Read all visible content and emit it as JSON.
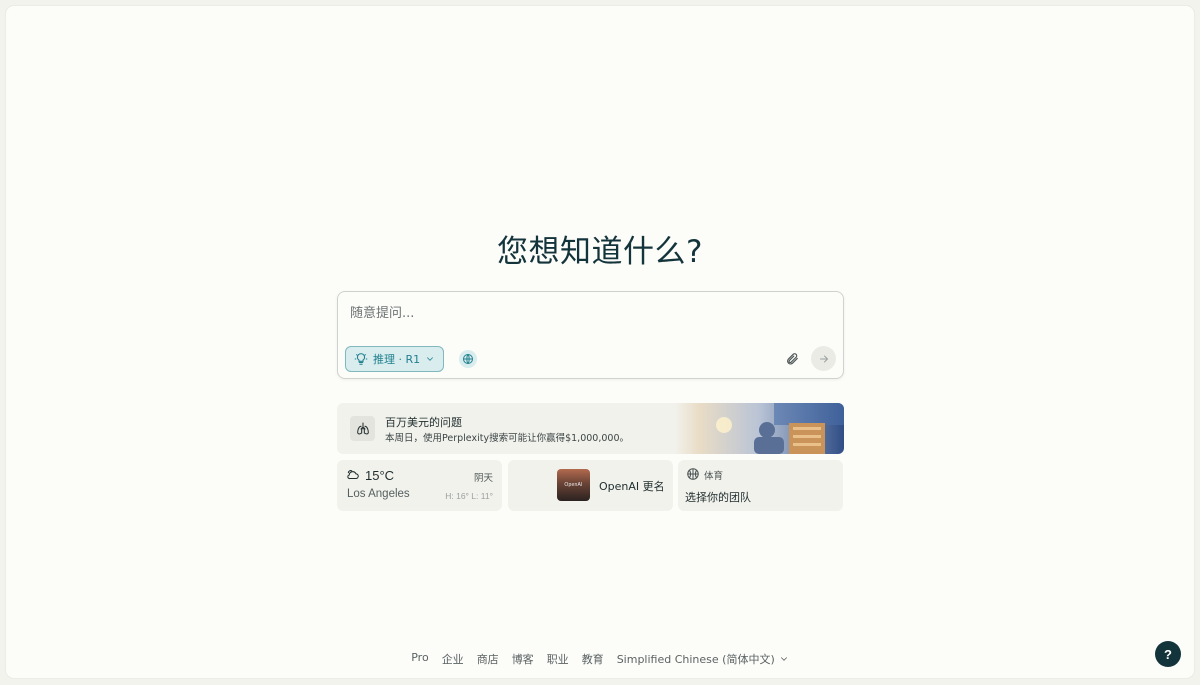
{
  "main": {
    "title": "您想知道什么?"
  },
  "search": {
    "placeholder": "随意提问...",
    "mode_label": "推理 · R1",
    "icons": {
      "mode": "lightbulb-icon",
      "mode_dropdown": "chevron-down-icon",
      "web": "globe-icon",
      "attach": "paperclip-icon",
      "submit": "arrow-right-icon"
    }
  },
  "promo": {
    "title": "百万美元的问题",
    "subtitle": "本周日，使用Perplexity搜索可能让你赢得$1,000,000。",
    "icon": "lungs-icon"
  },
  "widgets": {
    "weather": {
      "temperature": "15°C",
      "condition": "阴天",
      "city": "Los Angeles",
      "hilo": "H: 16° L: 11°",
      "icon": "cloud-icon"
    },
    "news": {
      "thumb_text": "OpenAI",
      "title": "OpenAI 更名"
    },
    "sports": {
      "label": "体育",
      "title": "选择你的团队",
      "icon": "basketball-icon"
    }
  },
  "footer": {
    "links": [
      "Pro",
      "企业",
      "商店",
      "博客",
      "职业",
      "教育"
    ],
    "language": "Simplified Chinese (简体中文)"
  },
  "help": {
    "label": "?"
  },
  "colors": {
    "accent": "#20808d",
    "title": "#13343b",
    "background": "#fcfcf9",
    "card": "#f2f2ed"
  }
}
